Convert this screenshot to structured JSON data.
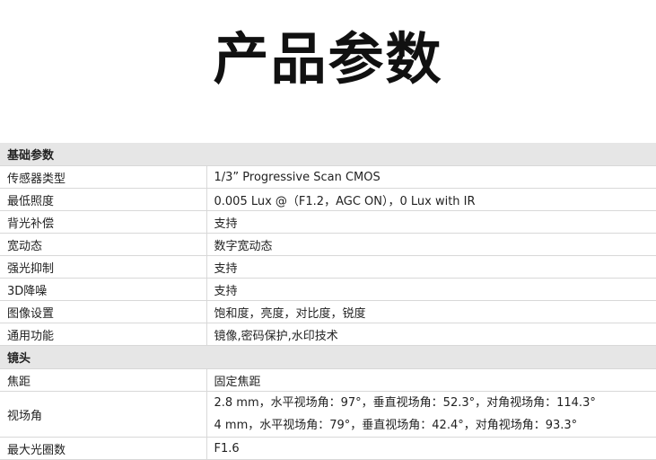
{
  "title": "产品参数",
  "sections": {
    "basic": {
      "header": "基础参数",
      "rows": [
        {
          "label": "传感器类型",
          "value": "1/3” Progressive Scan CMOS"
        },
        {
          "label": "最低照度",
          "value": "0.005 Lux @（F1.2，AGC ON），0 Lux with IR"
        },
        {
          "label": "背光补偿",
          "value": "支持"
        },
        {
          "label": "宽动态",
          "value": "数字宽动态"
        },
        {
          "label": "强光抑制",
          "value": "支持"
        },
        {
          "label": "3D降噪",
          "value": "支持"
        },
        {
          "label": "图像设置",
          "value": "饱和度，亮度，对比度，锐度"
        },
        {
          "label": "通用功能",
          "value": "镜像,密码保护,水印技术"
        }
      ]
    },
    "lens": {
      "header": "镜头",
      "focal": {
        "label": "焦距",
        "value": "固定焦距"
      },
      "fov": {
        "label": "视场角",
        "line1": "2.8 mm，水平视场角：97°，垂直视场角：52.3°，对角视场角：114.3°",
        "line2": "4 mm，水平视场角：79°，垂直视场角：42.4°，对角视场角：93.3°"
      },
      "aperture": {
        "label": "最大光圈数",
        "value": "F1.6"
      }
    }
  }
}
